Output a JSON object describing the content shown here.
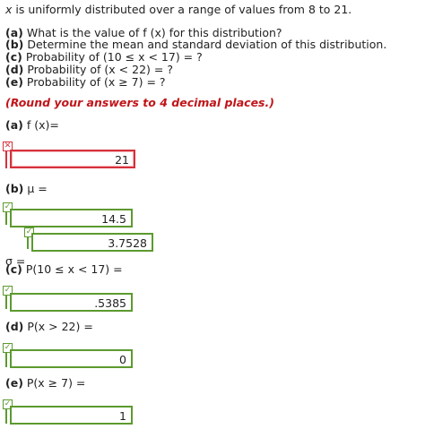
{
  "header": {
    "var": "x",
    "text": " is uniformly distributed over a range of values from 8 to 21."
  },
  "questions": [
    {
      "label": "(a)",
      "text": "What is the value of f (x) for this distribution?"
    },
    {
      "label": "(b)",
      "text": "Determine the mean and standard deviation of this distribution."
    },
    {
      "label": "(c)",
      "text": "Probability of (10 ≤ x < 17) = ?"
    },
    {
      "label": "(d)",
      "text": "Probability of (x < 22) = ?"
    },
    {
      "label": "(e)",
      "text": "Probability of (x ≥ 7) = ?"
    }
  ],
  "instruction": "(Round your answers to 4 decimal places.)",
  "parts": {
    "a": {
      "label": "(a)",
      "prompt": "f (x)=",
      "value": "21",
      "status": "incorrect"
    },
    "b": {
      "label": "(b)",
      "prompt": "μ =",
      "mean_value": "14.5",
      "sigma_prompt": "σ =",
      "sd_value": "3.7528",
      "status": "correct"
    },
    "c": {
      "label": "(c)",
      "prompt": "P(10 ≤ x < 17) =",
      "value": ".5385",
      "status": "correct"
    },
    "d": {
      "label": "(d)",
      "prompt": "P(x > 22) =",
      "value": "0",
      "status": "correct"
    },
    "e": {
      "label": "(e)",
      "prompt": "P(x ≥ 7) =",
      "value": "1",
      "status": "correct"
    }
  },
  "colors": {
    "error": "#d6313b",
    "correct": "#5c9a2f",
    "instruction": "#c0151a"
  },
  "icons": {
    "incorrect": "x-mark-icon",
    "correct": "check-mark-icon"
  }
}
